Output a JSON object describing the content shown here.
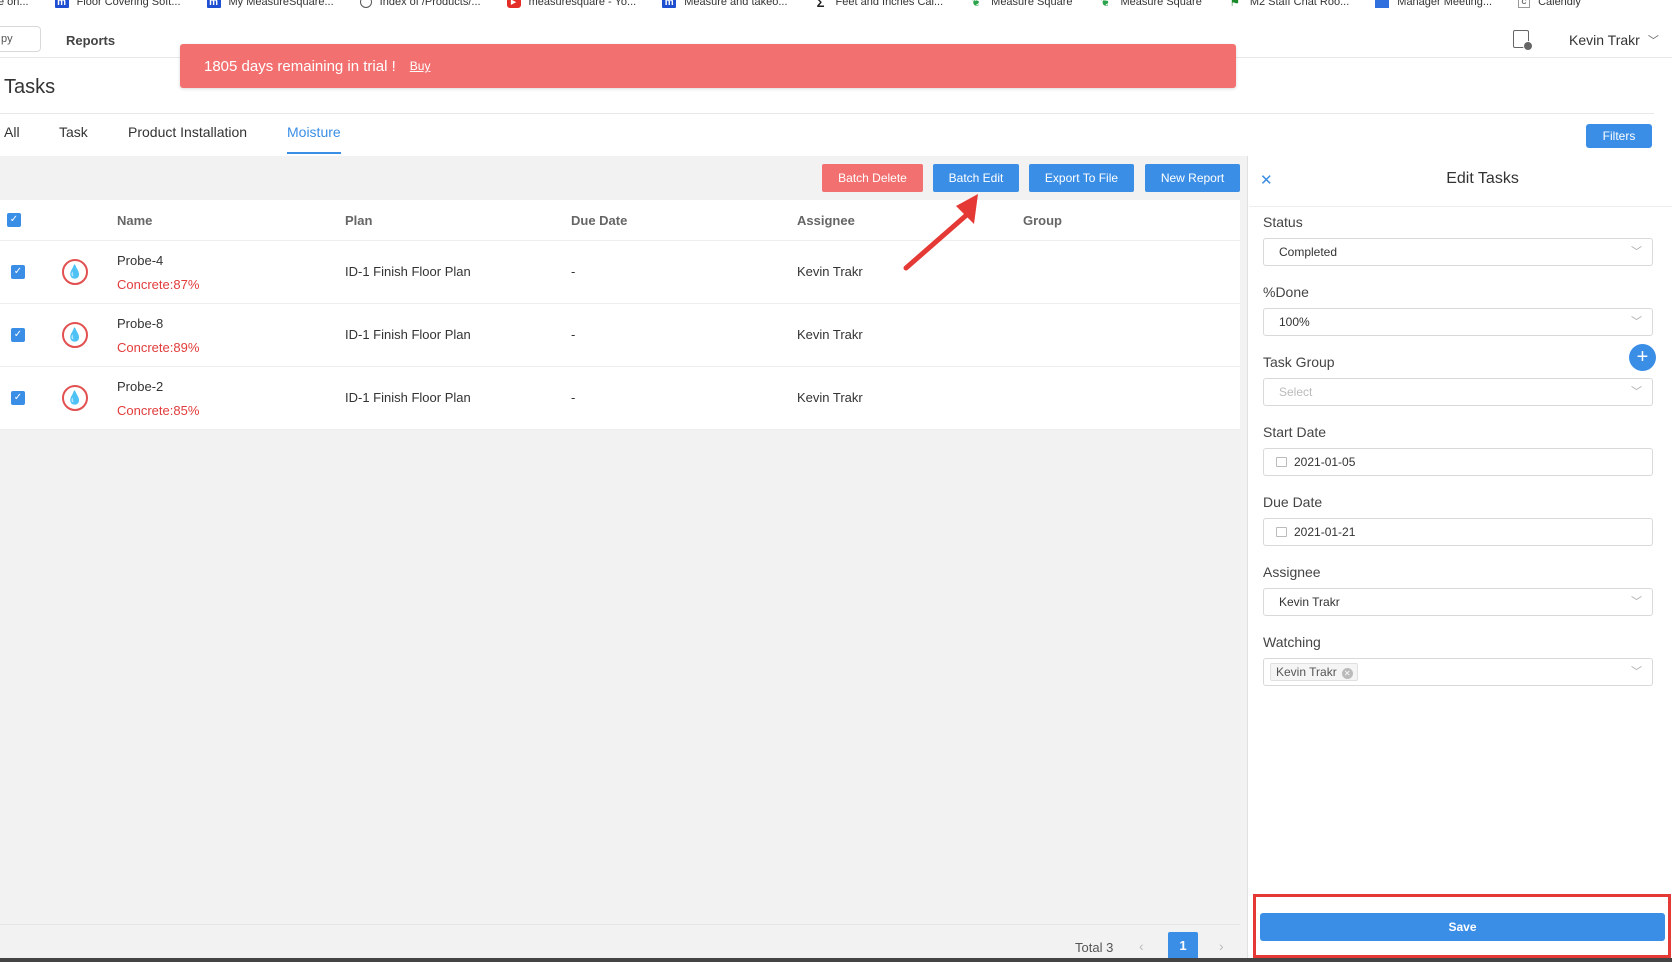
{
  "bookmarks": [
    {
      "label": "e on...",
      "icon": "bookmark-icon"
    },
    {
      "label": "Floor Covering Soft...",
      "icon": "measuresquare-m-icon"
    },
    {
      "label": "My MeasureSquare...",
      "icon": "measuresquare-m-icon"
    },
    {
      "label": "Index of /Products/...",
      "icon": "globe-icon"
    },
    {
      "label": "measuresquare - Yo...",
      "icon": "youtube-icon"
    },
    {
      "label": "Measure and takeo...",
      "icon": "measuresquare-m-icon"
    },
    {
      "label": "Feet and Inches Cal...",
      "icon": "sigma-icon"
    },
    {
      "label": "Measure Square",
      "icon": "leaf-icon"
    },
    {
      "label": "Measure Square",
      "icon": "leaf-icon"
    },
    {
      "label": "M2 Staff Chat Roo...",
      "icon": "flag-icon"
    },
    {
      "label": "Manager Meeting...",
      "icon": "doc-icon"
    },
    {
      "label": "Calendly",
      "icon": "calendar-icon"
    }
  ],
  "nav": {
    "left_button_fragment": "py",
    "reports": "Reports",
    "user": "Kevin Trakr"
  },
  "trial": {
    "message": "1805 days remaining in trial !",
    "buy": "Buy"
  },
  "page": {
    "title": "Tasks"
  },
  "tabs": [
    {
      "label": "All",
      "active": false
    },
    {
      "label": "Task",
      "active": false
    },
    {
      "label": "Product Installation",
      "active": false
    },
    {
      "label": "Moisture",
      "active": true
    }
  ],
  "filters_label": "Filters",
  "toolbar": {
    "batch_delete": "Batch Delete",
    "batch_edit": "Batch Edit",
    "export": "Export To File",
    "new_report": "New Report"
  },
  "table": {
    "columns": [
      "Name",
      "Plan",
      "Due Date",
      "Assignee",
      "Group"
    ],
    "rows": [
      {
        "name": "Probe-4",
        "reading": "Concrete:87%",
        "plan": "ID-1 Finish Floor Plan",
        "due": "-",
        "assignee": "Kevin Trakr",
        "group": "",
        "checked": true
      },
      {
        "name": "Probe-8",
        "reading": "Concrete:89%",
        "plan": "ID-1 Finish Floor Plan",
        "due": "-",
        "assignee": "Kevin Trakr",
        "group": "",
        "checked": true
      },
      {
        "name": "Probe-2",
        "reading": "Concrete:85%",
        "plan": "ID-1 Finish Floor Plan",
        "due": "-",
        "assignee": "Kevin Trakr",
        "group": "",
        "checked": true
      }
    ]
  },
  "pagination": {
    "total": "Total 3",
    "current": "1"
  },
  "panel": {
    "title": "Edit Tasks",
    "status_label": "Status",
    "status_value": "Completed",
    "done_label": "%Done",
    "done_value": "100%",
    "group_label": "Task Group",
    "group_placeholder": "Select",
    "start_label": "Start Date",
    "start_value": "2021-01-05",
    "due_label": "Due Date",
    "due_value": "2021-01-21",
    "assignee_label": "Assignee",
    "assignee_value": "Kevin Trakr",
    "watching_label": "Watching",
    "watching_tag": "Kevin Trakr",
    "save": "Save"
  },
  "colors": {
    "accent": "#3a8ee6",
    "danger": "#f27070",
    "annotation": "#e53935"
  }
}
